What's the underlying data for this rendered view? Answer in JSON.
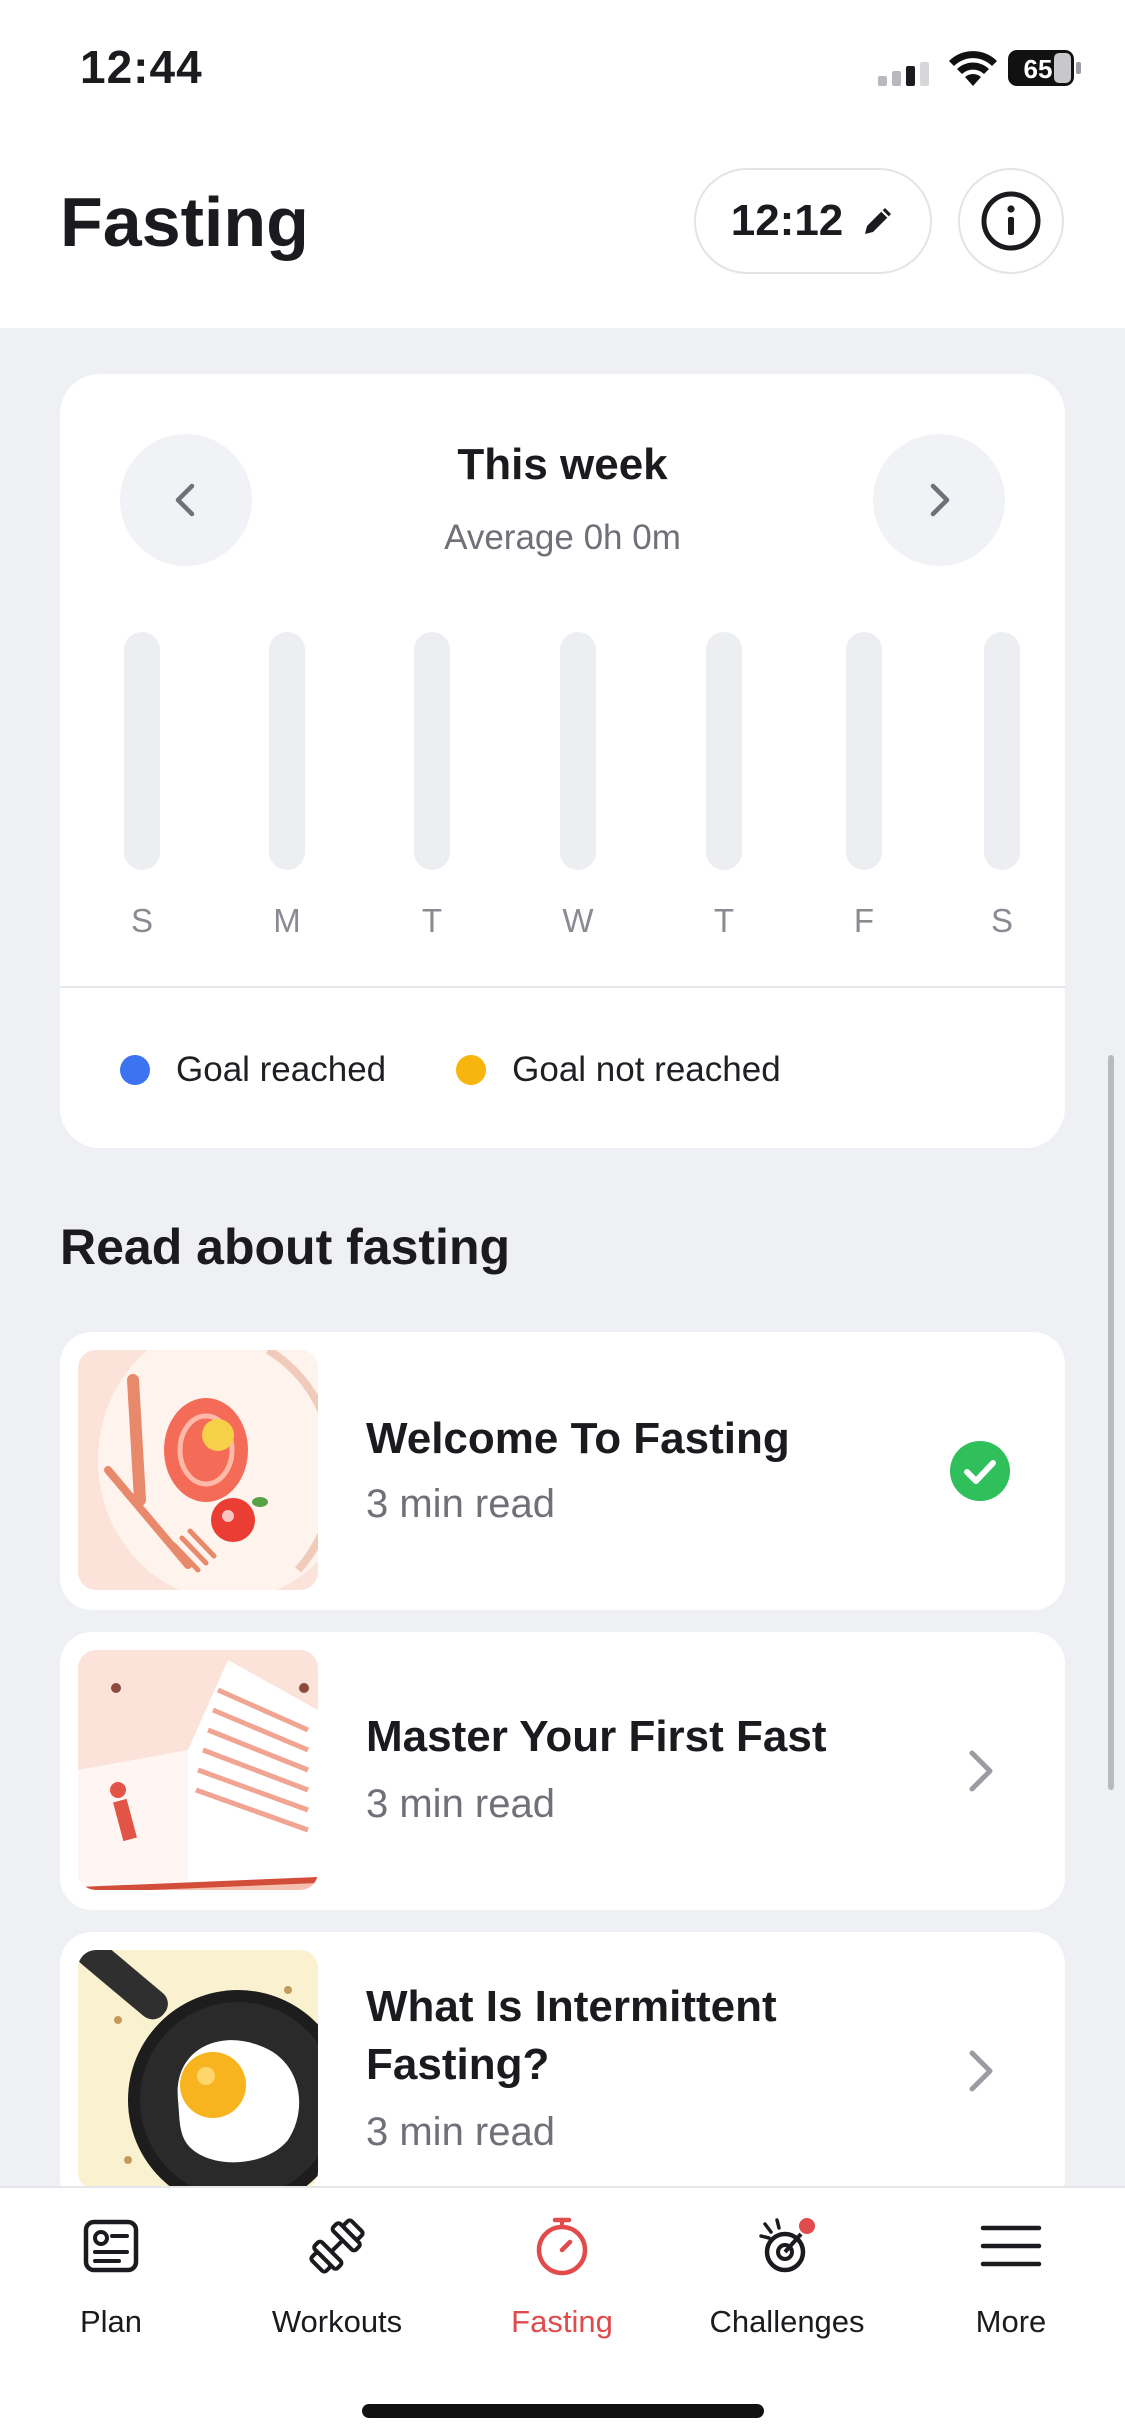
{
  "status_bar": {
    "time": "12:44",
    "battery": "65"
  },
  "header": {
    "title": "Fasting",
    "schedule": "12:12"
  },
  "week": {
    "title": "This week",
    "average": "Average 0h 0m",
    "days": [
      "S",
      "M",
      "T",
      "W",
      "T",
      "F",
      "S"
    ]
  },
  "legend": [
    {
      "label": "Goal reached",
      "color": "#3b73f0"
    },
    {
      "label": "Goal not reached",
      "color": "#f6b60d"
    }
  ],
  "articles_section": {
    "title": "Read about fasting",
    "items": [
      {
        "title": "Welcome To Fasting",
        "meta": "3 min read",
        "status": "check-circle-icon"
      },
      {
        "title": "Master Your First Fast",
        "meta": "3 min read",
        "status": "chevron-right-icon"
      },
      {
        "title_line1": "What Is Intermittent",
        "title_line2": "Fasting?",
        "meta": "3 min read",
        "status": "chevron-right-icon"
      }
    ]
  },
  "tabs": [
    {
      "label": "Plan",
      "icon": "plan-icon"
    },
    {
      "label": "Workouts",
      "icon": "dumbbell-icon"
    },
    {
      "label": "Fasting",
      "icon": "stopwatch-icon",
      "active": true
    },
    {
      "label": "Challenges",
      "icon": "challenges-icon",
      "badge": true
    },
    {
      "label": "More",
      "icon": "menu-icon"
    }
  ],
  "colors": {
    "accent": "#e24b4b",
    "success": "#2fbf5b",
    "background": "#eff0f4"
  }
}
